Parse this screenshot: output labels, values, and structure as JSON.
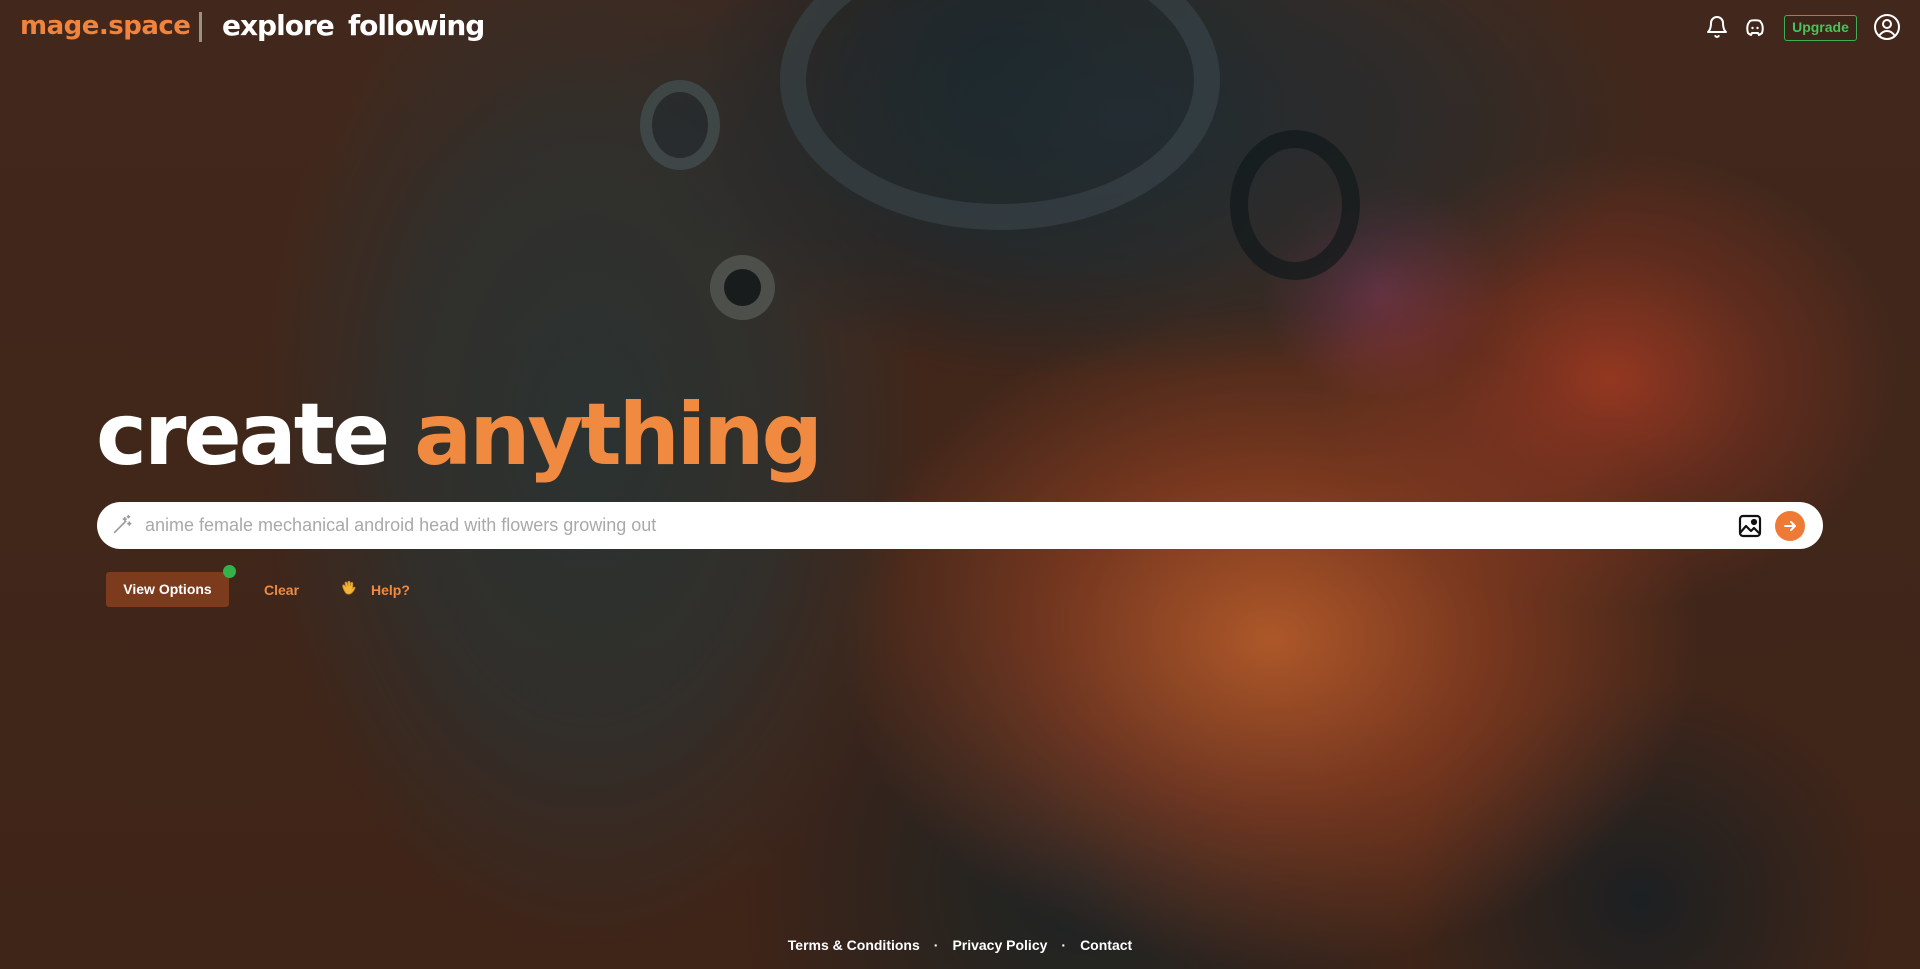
{
  "header": {
    "logo": "mage.space",
    "nav": {
      "explore": "explore",
      "following": "following"
    },
    "upgrade_label": "Upgrade",
    "icons": [
      "bell-icon",
      "discord-icon",
      "user-icon"
    ]
  },
  "hero": {
    "title_word1": "create",
    "title_word2": "anything"
  },
  "prompt": {
    "placeholder": "anime female mechanical android head with flowers growing out",
    "value": ""
  },
  "actions": {
    "view_options": "View Options",
    "clear": "Clear",
    "help": "Help?"
  },
  "footer": {
    "terms": "Terms & Conditions",
    "privacy": "Privacy Policy",
    "contact": "Contact",
    "separator": "·"
  },
  "colors": {
    "accent": "#f08a40",
    "upgrade": "#49c25c",
    "view_options_bg": "#7b3b1c",
    "status_dot": "#34b24a"
  }
}
